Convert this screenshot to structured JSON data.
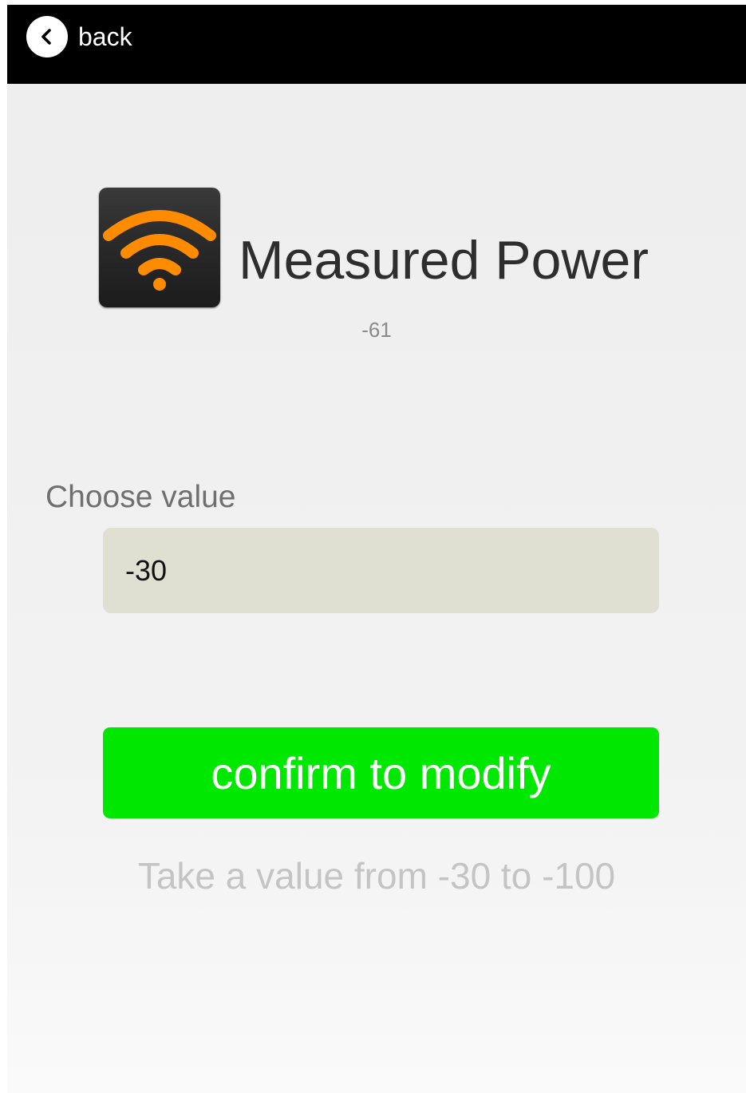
{
  "topbar": {
    "back_label": "back",
    "back_icon": "chevron-left-icon"
  },
  "header": {
    "icon": "wifi-signal-icon",
    "title": "Measured Power",
    "current_value": "-61"
  },
  "form": {
    "choose_label": "Choose value",
    "input_value": "-30",
    "confirm_label": "confirm to modify",
    "hint": "Take a value from -30 to -100"
  },
  "colors": {
    "topbar": "#000000",
    "confirm_button": "#00e800",
    "input_background": "#dfdfd2",
    "icon_accent": "#ff8c00"
  }
}
